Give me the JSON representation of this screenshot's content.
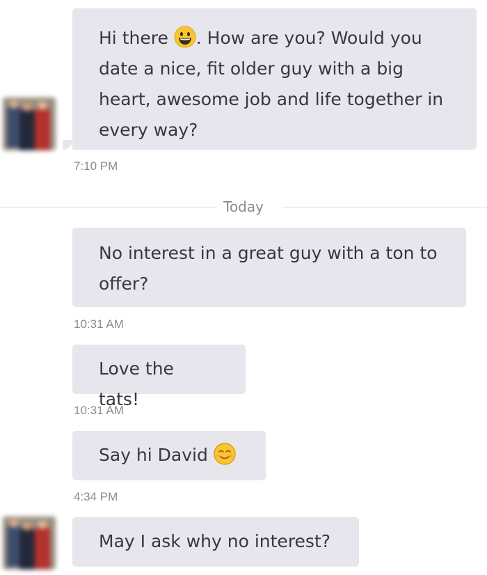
{
  "messages": [
    {
      "text_before": "Hi there ",
      "emoji": "grinning-face-emoji",
      "text_after": ". How are you? Would you date a nice, fit older guy with a big heart, awesome job and life together in every way?",
      "time": "7:10 PM"
    },
    {
      "text": "No interest in a great guy with a ton to offer?",
      "time": "10:31 AM"
    },
    {
      "text": "Love the tats!",
      "time": "10:31 AM"
    },
    {
      "text_before": "Say hi David ",
      "emoji": "smiling-face-emoji",
      "time": "4:34 PM"
    },
    {
      "text": "May I ask why no interest?"
    }
  ],
  "divider": {
    "label": "Today"
  },
  "colors": {
    "bubble": "#e6e6ec",
    "text": "#37373f",
    "timestamp": "#8a8a94",
    "emoji_face": "#f7c630"
  }
}
